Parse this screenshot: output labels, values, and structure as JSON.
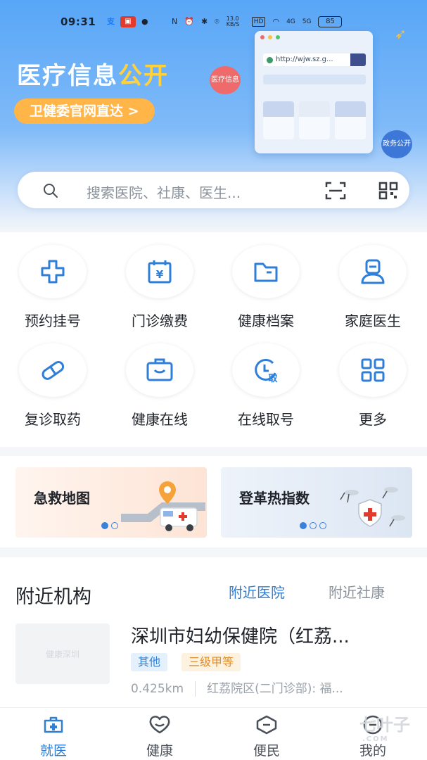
{
  "status_bar": {
    "time": "09:31",
    "network_speed": "13.0 KB/S",
    "hd_label": "HD",
    "signal_1": "4G",
    "signal_2": "5G",
    "battery": "85"
  },
  "hero": {
    "title_main": "医疗信息",
    "title_accent": "公开",
    "link_button": "卫健委官网直达 >",
    "browser_url": "http://wjw.sz.g...",
    "bubble_left": "医疗信息",
    "bubble_right": "政务公开"
  },
  "search": {
    "placeholder": "搜索医院、社康、医生..."
  },
  "services": [
    {
      "label": "预约挂号",
      "icon": "hospital-cross-icon"
    },
    {
      "label": "门诊缴费",
      "icon": "payment-calendar-icon"
    },
    {
      "label": "健康档案",
      "icon": "folder-icon"
    },
    {
      "label": "家庭医生",
      "icon": "doctor-icon"
    },
    {
      "label": "复诊取药",
      "icon": "pill-icon"
    },
    {
      "label": "健康在线",
      "icon": "briefcase-icon"
    },
    {
      "label": "在线取号",
      "icon": "clock-queue-icon"
    },
    {
      "label": "更多",
      "icon": "grid-more-icon"
    }
  ],
  "banners": [
    {
      "title": "急救地图"
    },
    {
      "title": "登革热指数"
    }
  ],
  "nearby": {
    "title": "附近机构",
    "tab_hospitals": "附近医院",
    "tab_community": "附近社康",
    "item": {
      "thumb_text": "健康深圳",
      "name": "深圳市妇幼保健院（红荔...",
      "tag_type": "其他",
      "tag_level": "三级甲等",
      "distance": "0.425km",
      "address": "红荔院区(二门诊部): 福..."
    }
  },
  "tabbar": {
    "items": [
      {
        "label": "就医",
        "active": true
      },
      {
        "label": "健康",
        "active": false
      },
      {
        "label": "便民",
        "active": false
      },
      {
        "label": "我的",
        "active": false
      }
    ]
  },
  "watermark": {
    "text": "七叶子",
    "domain": ".COM"
  },
  "colors": {
    "accent": "#2f7fd8",
    "hero_blue": "#58a6f7",
    "button_orange": "#ffb548",
    "title_yellow": "#ffd23c"
  }
}
